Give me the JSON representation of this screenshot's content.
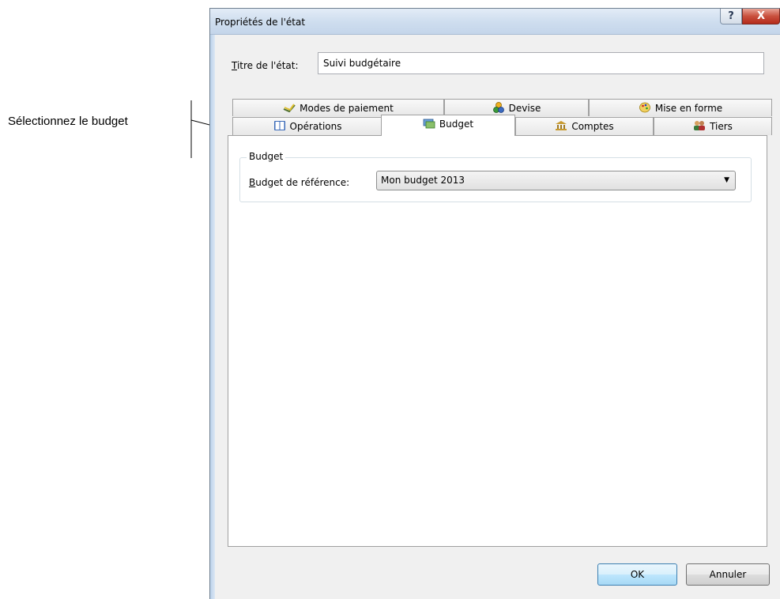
{
  "annotation": {
    "text": "Sélectionnez le budget"
  },
  "dialog": {
    "title": "Propriétés de l'état",
    "help_symbol": "?",
    "close_symbol": "X",
    "titre_label_accel": "T",
    "titre_label_rest": "itre de l'état:",
    "titre_value": "Suivi budgétaire",
    "tabs_row1": [
      {
        "label": "Modes de paiement",
        "icon": "payment-modes-icon"
      },
      {
        "label": "Devise",
        "icon": "currency-icon"
      },
      {
        "label": "Mise en forme",
        "icon": "formatting-icon"
      }
    ],
    "tabs_row2": [
      {
        "label": "Opérations",
        "icon": "book-icon"
      },
      {
        "label": "Budget",
        "icon": "budget-icon",
        "active": true
      },
      {
        "label": "Comptes",
        "icon": "bank-icon"
      },
      {
        "label": "Tiers",
        "icon": "people-icon"
      }
    ],
    "group_title": "Budget",
    "ref_label_accel": "B",
    "ref_label_rest": "udget de référence:",
    "ref_value": "Mon budget 2013",
    "ok_label": "OK",
    "cancel_label": "Annuler"
  }
}
